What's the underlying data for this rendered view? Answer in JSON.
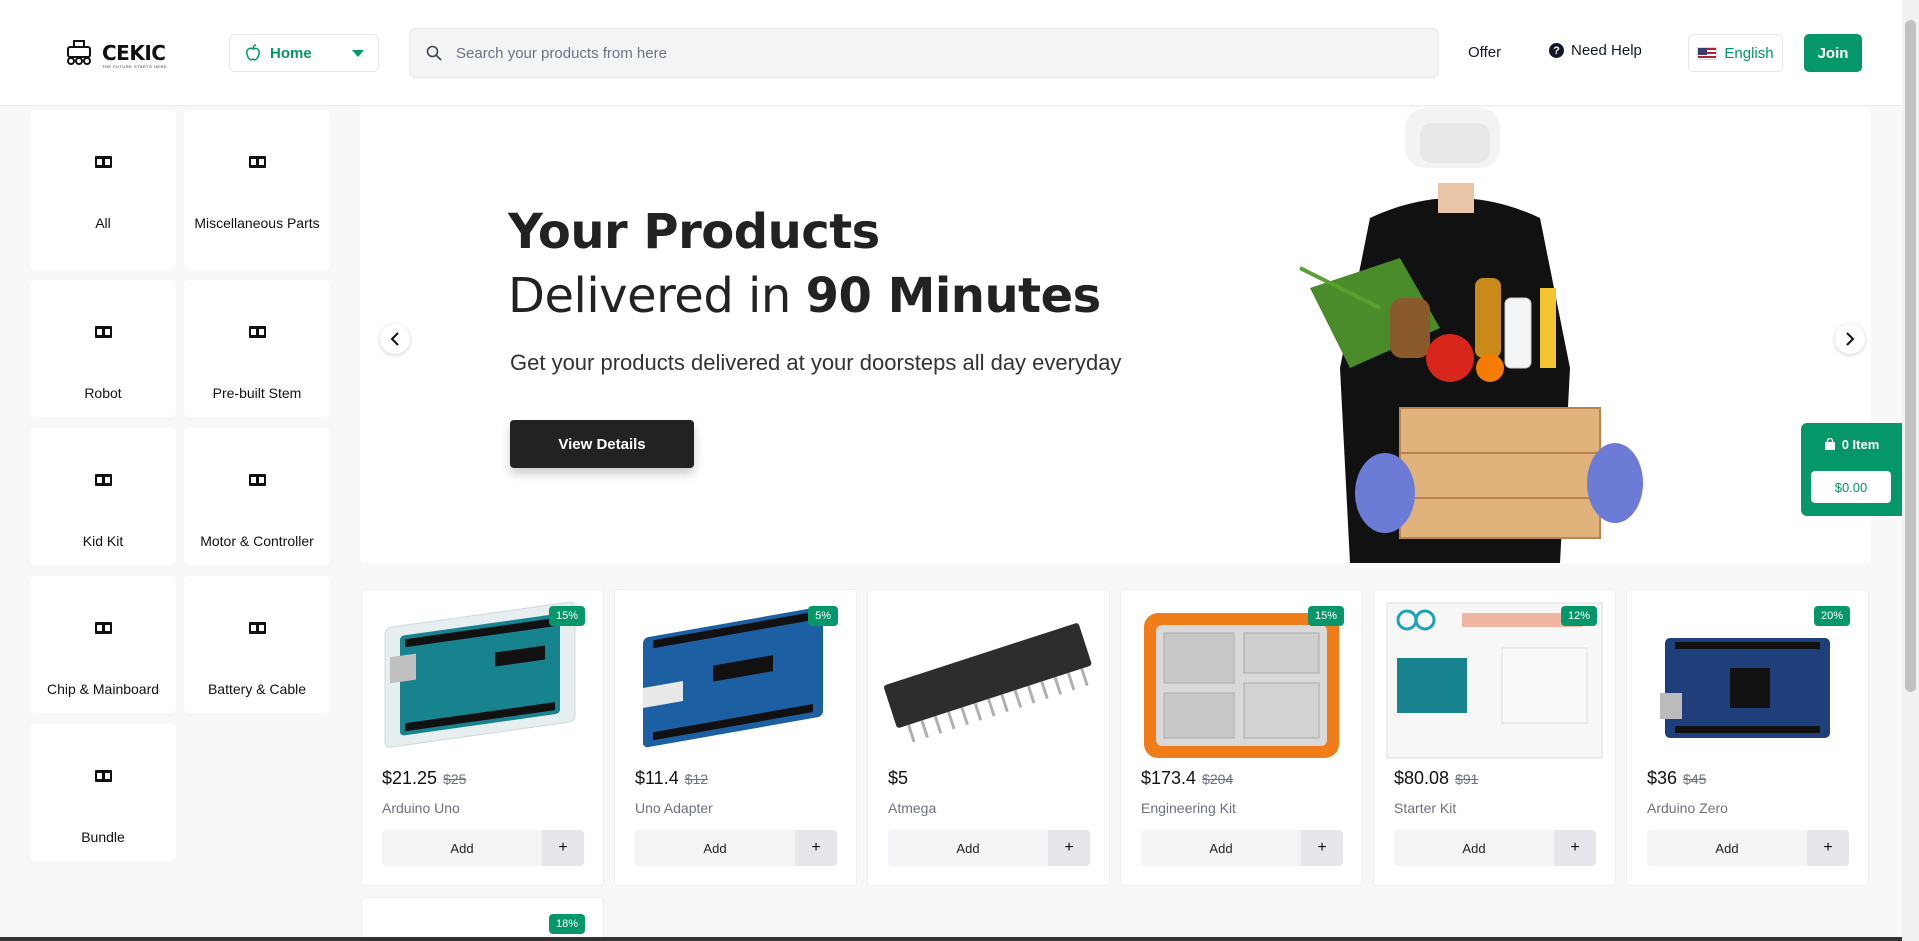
{
  "header": {
    "logo_text": "CEKIC",
    "logo_sub": "THE FUTURE STARTS HERE",
    "home_label": "Home",
    "search_placeholder": "Search your products from here",
    "offer_label": "Offer",
    "help_label": "Need Help",
    "language_label": "English",
    "join_label": "Join"
  },
  "categories": [
    {
      "label": "All"
    },
    {
      "label": "Miscellaneous Parts"
    },
    {
      "label": "Robot"
    },
    {
      "label": "Pre-built Stem"
    },
    {
      "label": "Kid Kit"
    },
    {
      "label": "Motor & Controller"
    },
    {
      "label": "Chip & Mainboard"
    },
    {
      "label": "Battery & Cable"
    },
    {
      "label": "Bundle"
    }
  ],
  "hero": {
    "title_line1": "Your Products",
    "title_line2_prefix": "Delivered in ",
    "title_line2_bold": "90 Minutes",
    "subtitle": "Get your products delivered at your doorsteps all day everyday",
    "button_label": "View Details"
  },
  "cart": {
    "items_label": "0 Item",
    "total": "$0.00"
  },
  "products": [
    {
      "name": "Arduino Uno",
      "price": "$21.25",
      "old_price": "$25",
      "discount": "15%"
    },
    {
      "name": "Uno Adapter",
      "price": "$11.4",
      "old_price": "$12",
      "discount": "5%"
    },
    {
      "name": "Atmega",
      "price": "$5",
      "old_price": "",
      "discount": ""
    },
    {
      "name": "Engineering Kit",
      "price": "$173.4",
      "old_price": "$204",
      "discount": "15%"
    },
    {
      "name": "Starter Kit",
      "price": "$80.08",
      "old_price": "$91",
      "discount": "12%"
    },
    {
      "name": "Arduino Zero",
      "price": "$36",
      "old_price": "$45",
      "discount": "20%"
    }
  ],
  "product_add_label": "Add",
  "partial_product_discount": "18%"
}
